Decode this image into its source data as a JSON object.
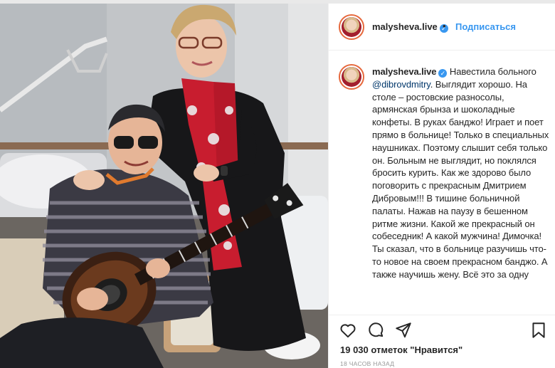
{
  "post": {
    "username": "malysheva.live",
    "follow_label": "Подписаться",
    "separator": "•",
    "verified_glyph": "✓",
    "caption_intro": "Навестила больного ",
    "mention": "@dibrovdmitry",
    "caption_rest": ". Выглядит хорошо. На столе – ростовские разносолы, армянская брынза и шоколадные конфеты. В руках банджо! Играет и поет прямо в больнице! Только в специальных наушниках. Поэтому слышит себя только он. Больным не выглядит, но поклялся бросить курить. Как же здорово было поговорить с прекрасным Дмитрием Дибровым!!! В тишине больничной палаты. Нажав на паузу в бешенном ритме жизни. Какой же прекрасный он собеседник! А какой мужчина! Димочка! Ты сказал, что в больнице разучишь что-то новое на своем прекрасном банджо. А также научишь жену. Всё это за одну",
    "likes": "19 030 отметок \"Нравится\"",
    "time": "18 часов назад",
    "icons": {
      "like": "heart-icon",
      "comment": "comment-icon",
      "share": "share-icon",
      "save": "bookmark-icon",
      "avatar": "avatar-icon"
    }
  },
  "colors": {
    "link": "#3897f0",
    "mention": "#00376b",
    "text": "#262626",
    "muted": "#999999",
    "border": "#efefef"
  }
}
